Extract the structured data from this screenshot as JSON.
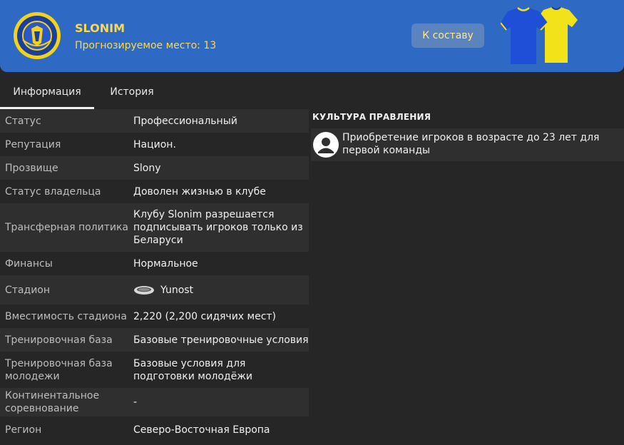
{
  "header": {
    "club_name": "SLONIM",
    "predicted_position": "Прогнозируемое место: 13",
    "squad_button_label": "К составу",
    "colors": {
      "banner": "#2e6ac4",
      "accent": "#ffd84a",
      "kit_home": "#1e4fd6",
      "kit_away": "#f2e21a"
    }
  },
  "tabs": [
    {
      "label": "Информация"
    },
    {
      "label": "История"
    }
  ],
  "info": [
    {
      "label": "Статус",
      "value": "Профессиональный"
    },
    {
      "label": "Репутация",
      "value": "Национ."
    },
    {
      "label": "Прозвище",
      "value": "Slony"
    },
    {
      "label": "Статус владельца",
      "value": "Доволен жизнью в клубе"
    },
    {
      "label": "Трансферная политика",
      "value": "Клубу Slonim разрешается подписывать игроков только из Беларуси"
    },
    {
      "label": "Финансы",
      "value": "Нормальное"
    },
    {
      "label": "Стадион",
      "value": "Yunost",
      "icon": "stadium-icon"
    },
    {
      "label": "Вместимость стадиона",
      "value": "2,220 (2,200 сидячих мест)"
    },
    {
      "label": "Тренировочная база",
      "value": "Базовые тренировочные условия"
    },
    {
      "label": "Тренировочная база молодежи",
      "value": "Базовые условия для подготовки молодёжи"
    },
    {
      "label": "Континентальное соревнование",
      "value": "-"
    },
    {
      "label": "Регион",
      "value": "Северо-Восточная Европа"
    }
  ],
  "culture": {
    "title": "КУЛЬТУРА ПРАВЛЕНИЯ",
    "items": [
      {
        "text": "Приобретение игроков в возрасте до 23 лет для первой команды",
        "icon": "person-icon"
      }
    ]
  }
}
